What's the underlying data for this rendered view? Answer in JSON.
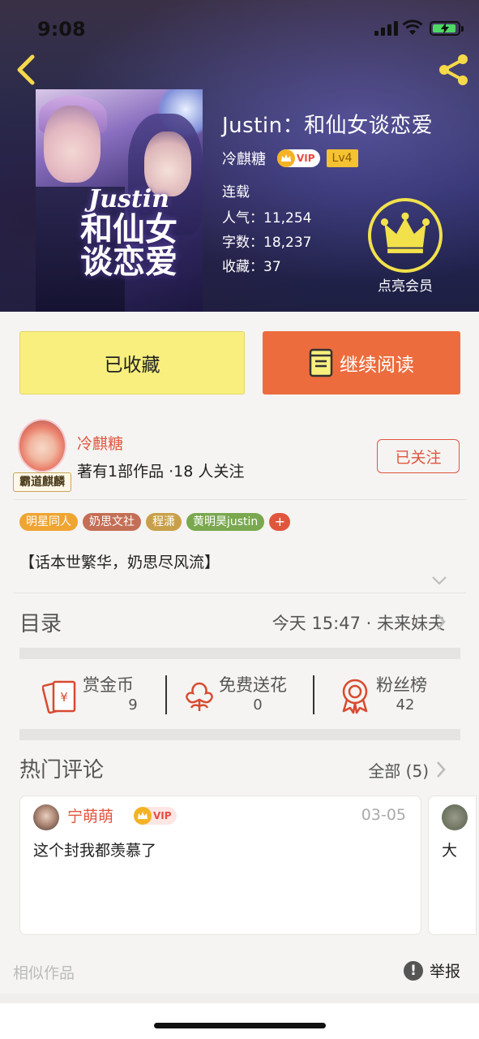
{
  "status_bar": {
    "time": "9:08"
  },
  "book": {
    "title": "Justin：和仙女谈恋爱",
    "author": "冷麒糖",
    "vip_label": "VIP",
    "level": "Lv4",
    "status": "连载",
    "popularity_label": "人气：",
    "popularity": "11,254",
    "words_label": "字数：",
    "words": "18,237",
    "favorites_label": "收藏：",
    "favorites": "37",
    "cover": {
      "title_en": "Justin",
      "title_cn": "和仙女谈恋爱"
    }
  },
  "membership_label": "点亮会员",
  "actions": {
    "favorited": "已收藏",
    "continue_reading": "继续阅读"
  },
  "author_profile": {
    "name": "冷麒糖",
    "meta": "著有1部作品 ·18 人关注",
    "avatar_tag": "霸道麒麟",
    "follow_label": "已关注"
  },
  "tags": [
    {
      "label": "明星同人",
      "color": "#f0a431"
    },
    {
      "label": "奶思文社",
      "color": "#c46f55"
    },
    {
      "label": "程潇",
      "color": "#c9a04a"
    },
    {
      "label": "黄明昊justin",
      "color": "#7aa84f"
    }
  ],
  "tag_more": "+",
  "intro": "【话本世繁华，奶思尽风流】",
  "catalog": {
    "label": "目录",
    "update": "今天 15:47 · 未来妹夫"
  },
  "support": [
    {
      "title": "赏金币",
      "value": "9",
      "icon": "red-envelope-icon"
    },
    {
      "title": "免费送花",
      "value": "0",
      "icon": "flower-icon"
    },
    {
      "title": "粉丝榜",
      "value": "42",
      "icon": "medal-icon"
    }
  ],
  "comments": {
    "label": "热门评论",
    "all_label": "全部 (5)",
    "items": [
      {
        "user": "宁萌萌",
        "vip_label": "VIP",
        "date": "03-05",
        "text": "这个封我都羡慕了"
      },
      {
        "text": "大"
      }
    ]
  },
  "similar_label": "相似作品",
  "report_label": "举报",
  "colors": {
    "accent": "#e0563d",
    "read_button": "#ec6c3e",
    "fav_button": "#f8ef7e",
    "crown": "#f2e14b"
  }
}
